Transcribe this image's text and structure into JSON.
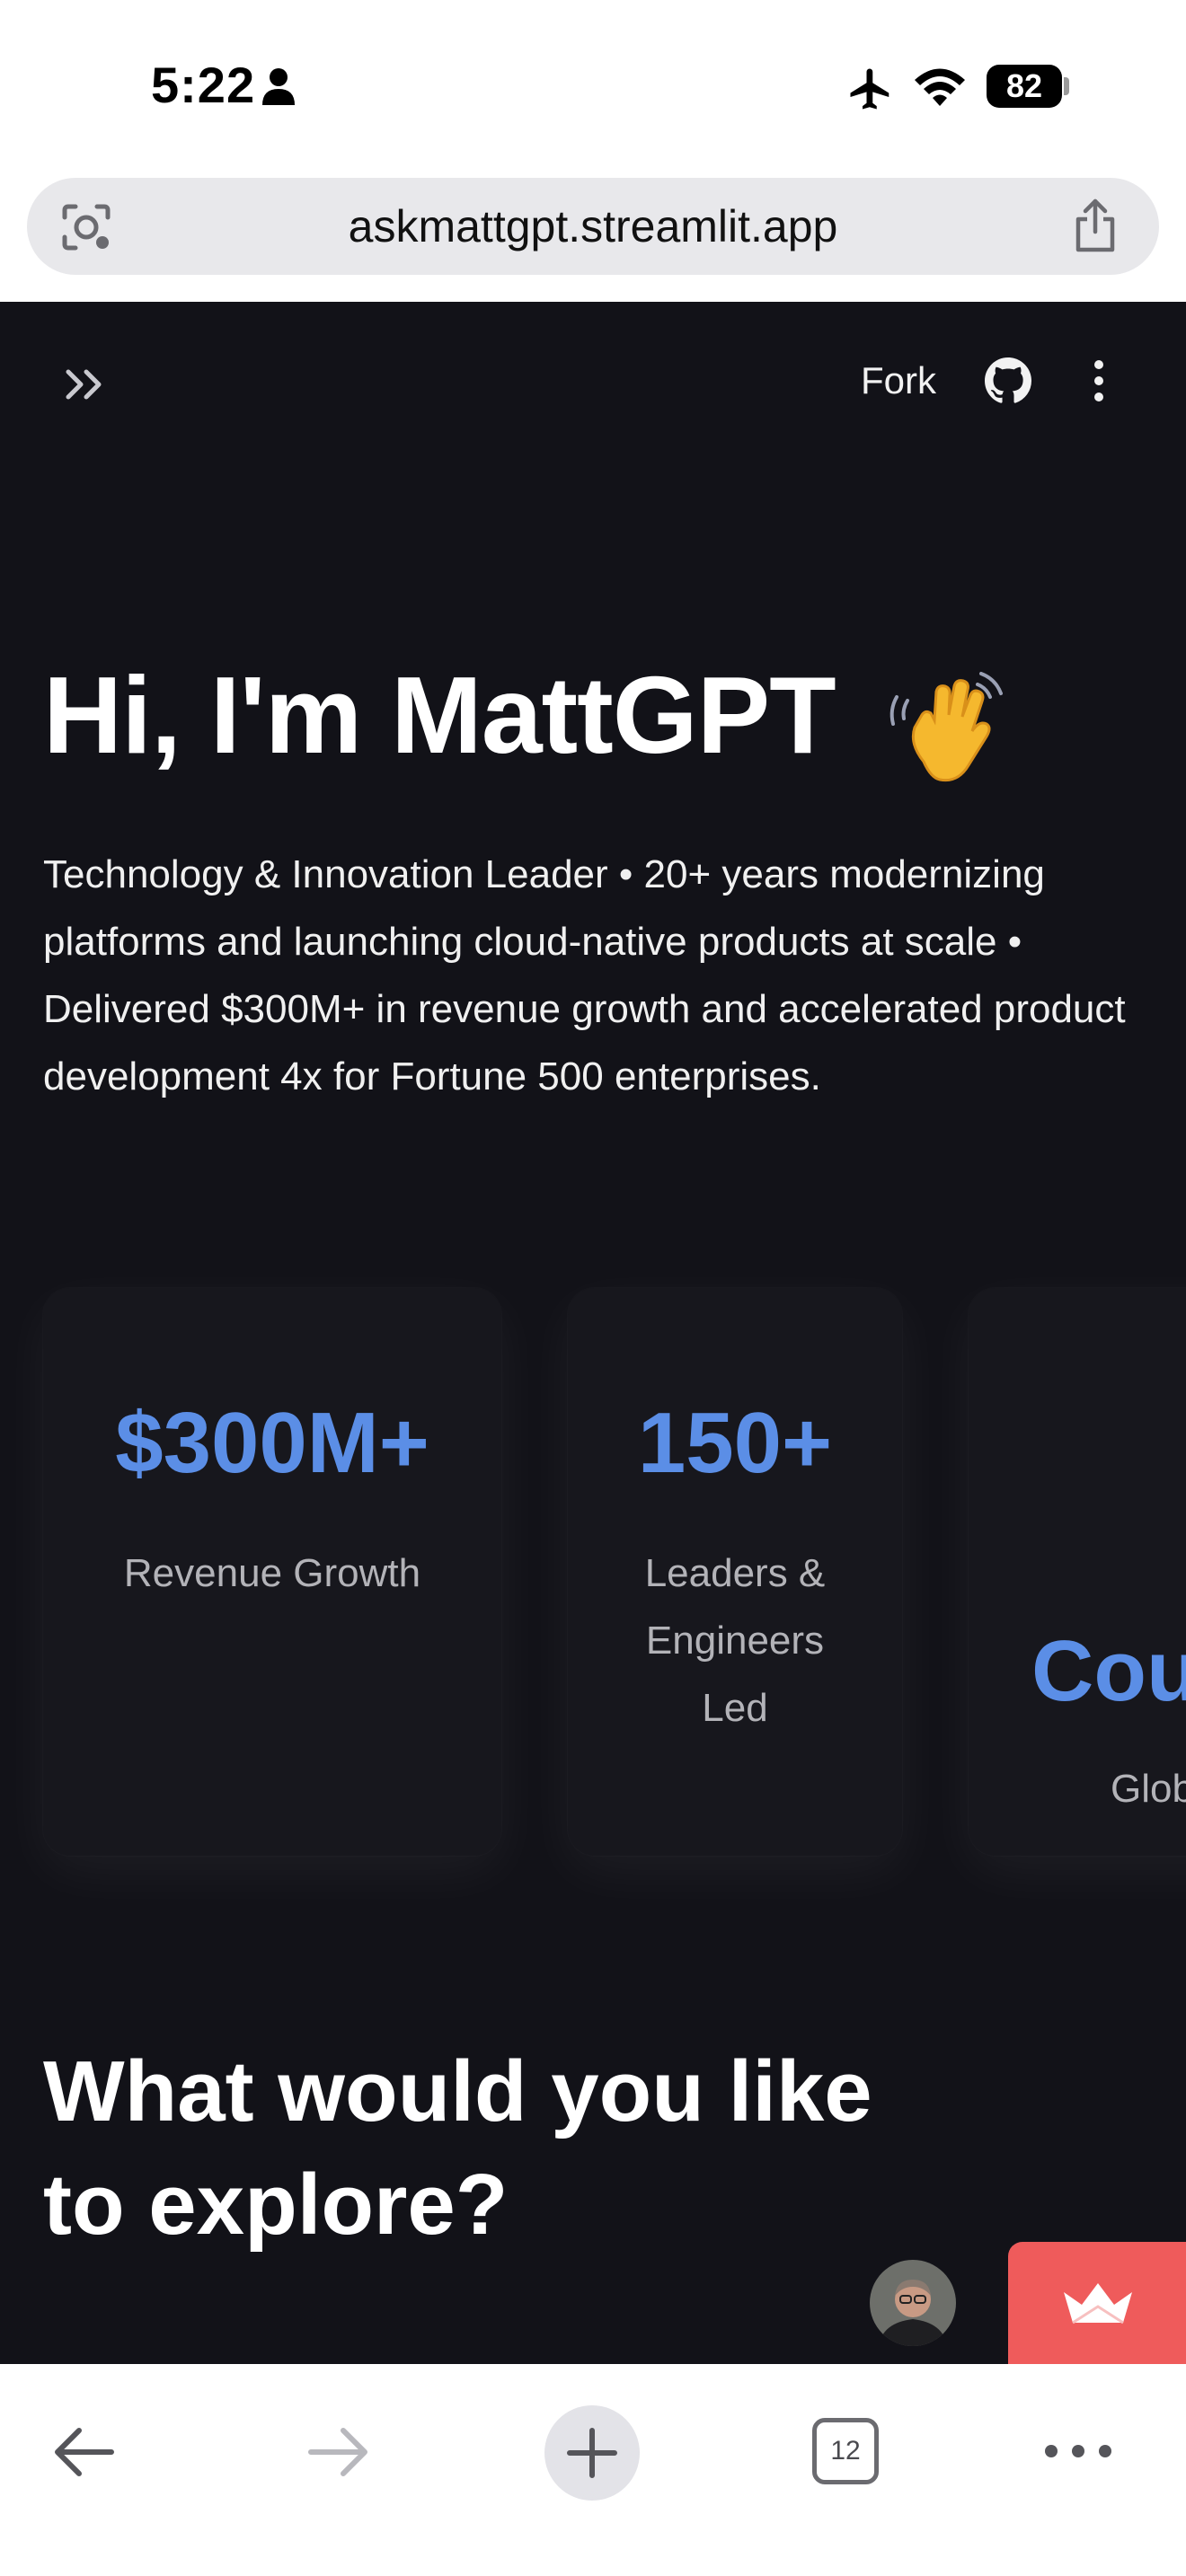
{
  "status_bar": {
    "time": "5:22",
    "battery": "82"
  },
  "url_bar": {
    "url": "askmattgpt.streamlit.app"
  },
  "header": {
    "fork_label": "Fork"
  },
  "hero": {
    "title": "Hi, I'm MattGPT",
    "subtitle": "Technology & Innovation Leader • 20+ years modernizing platforms and launching cloud-native products at scale • Delivered $300M+ in revenue growth and accelerated product development 4x for Fortune 500 enterprises."
  },
  "stats": [
    {
      "value": "$300M+",
      "label": "Revenue Growth"
    },
    {
      "value": "150+",
      "label": "Leaders & Engineers Led"
    },
    {
      "value": "Cou",
      "label": "Glob"
    }
  ],
  "explore": {
    "heading": "What would you like to explore?"
  },
  "toolbar": {
    "tab_count": "12"
  },
  "colors": {
    "app_background": "#121218",
    "accent": "#5b8ee6",
    "streamlit_badge": "#ef5b5b"
  }
}
